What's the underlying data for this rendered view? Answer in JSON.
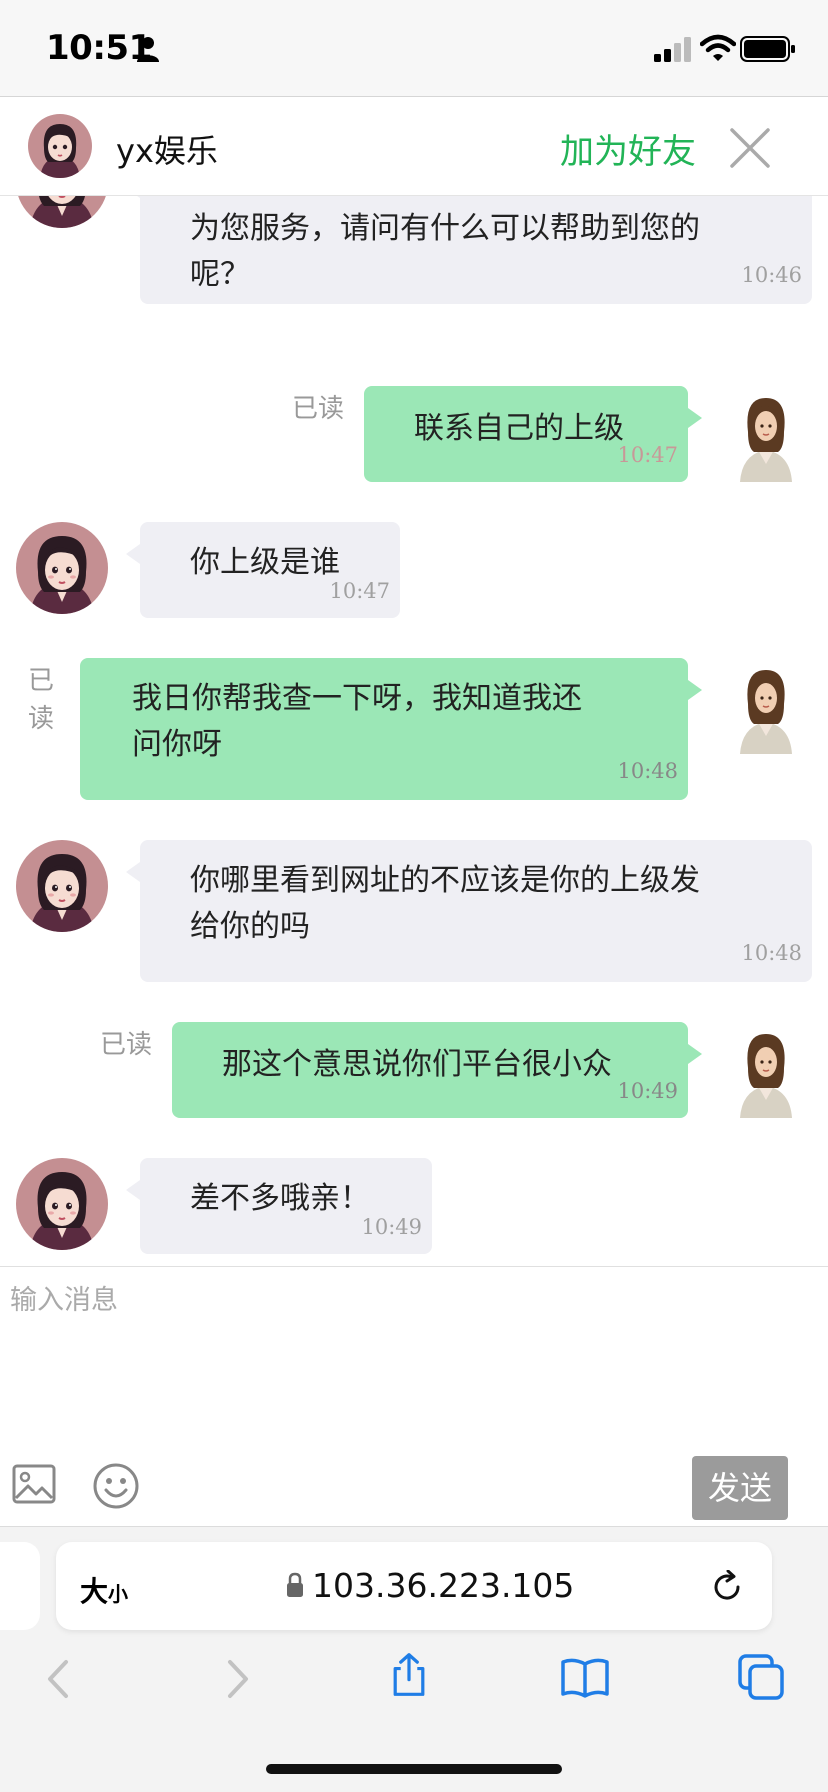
{
  "status_bar": {
    "time": "10:51"
  },
  "header": {
    "title": "yx娱乐",
    "add_friend": "加为好友",
    "close_icon": "close-icon"
  },
  "messages": [
    {
      "side": "left",
      "lines": [
        "为您服务，请问有什么可以帮助到您的",
        "呢？"
      ],
      "time": "10:46"
    },
    {
      "side": "right",
      "lines": [
        "联系自己的上级"
      ],
      "time": "10:47",
      "read": "已读"
    },
    {
      "side": "left",
      "lines": [
        "你上级是谁"
      ],
      "time": "10:47"
    },
    {
      "side": "right",
      "lines": [
        "我日你帮我查一下呀，我知道我还",
        "问你呀"
      ],
      "time": "10:48",
      "read": "已读"
    },
    {
      "side": "left",
      "lines": [
        "你哪里看到网址的不应该是你的上级发",
        "给你的吗"
      ],
      "time": "10:48"
    },
    {
      "side": "right",
      "lines": [
        "那这个意思说你们平台很小众"
      ],
      "time": "10:49",
      "read": "已读"
    },
    {
      "side": "left",
      "lines": [
        "差不多哦亲！"
      ],
      "time": "10:49"
    }
  ],
  "input": {
    "placeholder": "输入消息",
    "send_label": "发送"
  },
  "browser": {
    "text_size_big": "大",
    "text_size_small": "小",
    "url": "103.36.223.105"
  },
  "colors": {
    "accent": "#22b457",
    "right_bubble": "#9be7b6",
    "left_bubble": "#efeff4",
    "send_button": "#9b9b9b"
  }
}
